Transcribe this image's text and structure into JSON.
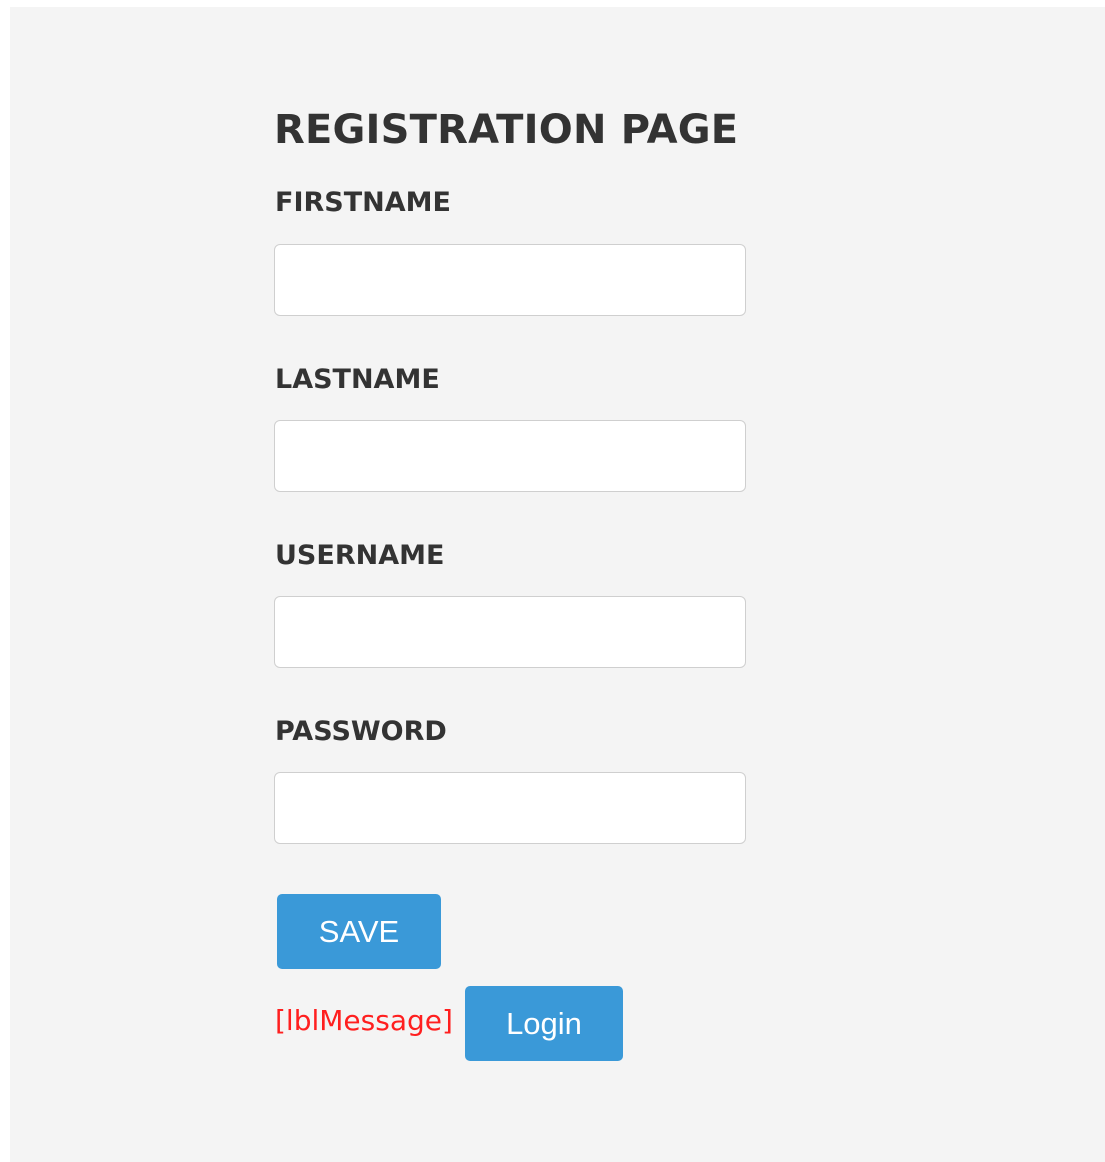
{
  "page": {
    "title": "REGISTRATION PAGE"
  },
  "fields": [
    {
      "label": "FIRSTNAME",
      "value": ""
    },
    {
      "label": "LASTNAME",
      "value": ""
    },
    {
      "label": "USERNAME",
      "value": ""
    },
    {
      "label": "PASSWORD",
      "value": ""
    }
  ],
  "actions": {
    "save_label": "SAVE",
    "message_label": "[lblMessage]",
    "login_label": "Login"
  },
  "colors": {
    "panel_background": "#f4f4f4",
    "button_background": "#3a99d8",
    "message_text": "#ff1f1f",
    "label_text": "#333333"
  }
}
